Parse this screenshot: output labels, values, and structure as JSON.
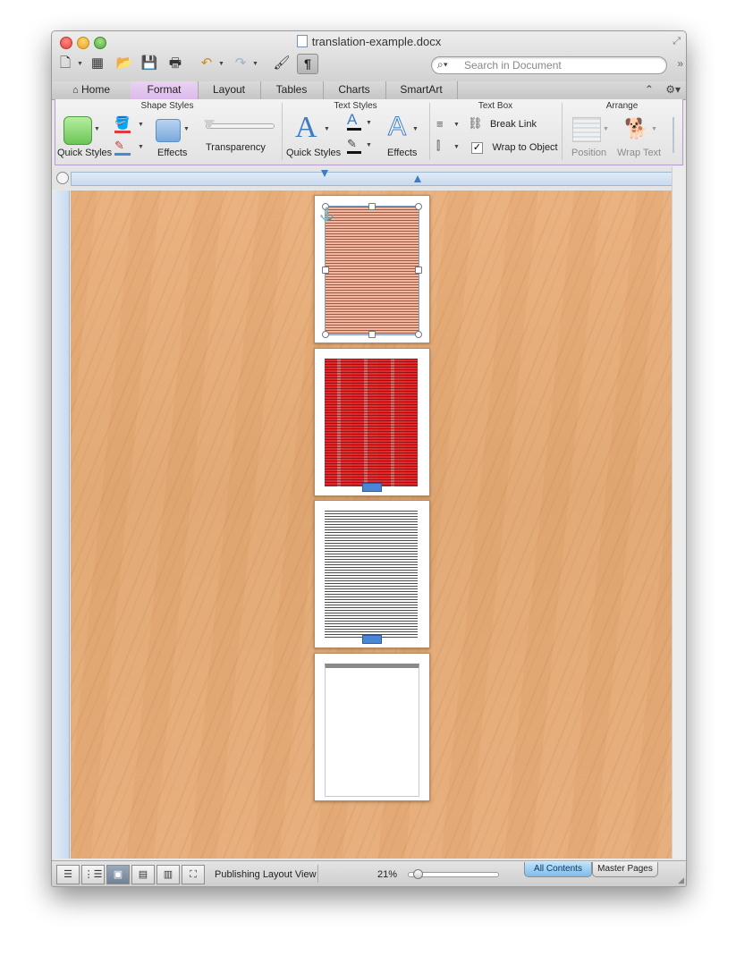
{
  "window": {
    "title": "translation-example.docx"
  },
  "toolbar": {
    "search_placeholder": "Search in Document"
  },
  "tabs": [
    {
      "label": "Home"
    },
    {
      "label": "Format",
      "active": true
    },
    {
      "label": "Layout"
    },
    {
      "label": "Tables"
    },
    {
      "label": "Charts"
    },
    {
      "label": "SmartArt"
    }
  ],
  "ribbon": {
    "groups": {
      "shape_styles": "Shape Styles",
      "text_styles": "Text Styles",
      "text_box": "Text Box",
      "arrange": "Arrange"
    },
    "labels": {
      "quick_styles": "Quick Styles",
      "effects": "Effects",
      "transparency": "Transparency",
      "text_quick_styles": "Quick Styles",
      "text_effects": "Effects",
      "break_link": "Break Link",
      "wrap_to_object": "Wrap to Object",
      "position": "Position",
      "wrap_text": "Wrap Text"
    }
  },
  "statusbar": {
    "view_name": "Publishing Layout View",
    "zoom": "21%",
    "tabs": {
      "all_contents": "All Contents",
      "master_pages": "Master Pages"
    }
  },
  "colors": {
    "format_tab": "#dcb9ea",
    "ribbon_border": "#b99bd1",
    "desk": "#e0a874",
    "page_orange": "#f6b59d",
    "page_red": "#e23030",
    "accent_blue": "#4a86d6"
  },
  "icons": {
    "home": "house-icon",
    "search": "magnifier-icon",
    "anchor": "anchor-icon",
    "settings": "gear-icon"
  }
}
